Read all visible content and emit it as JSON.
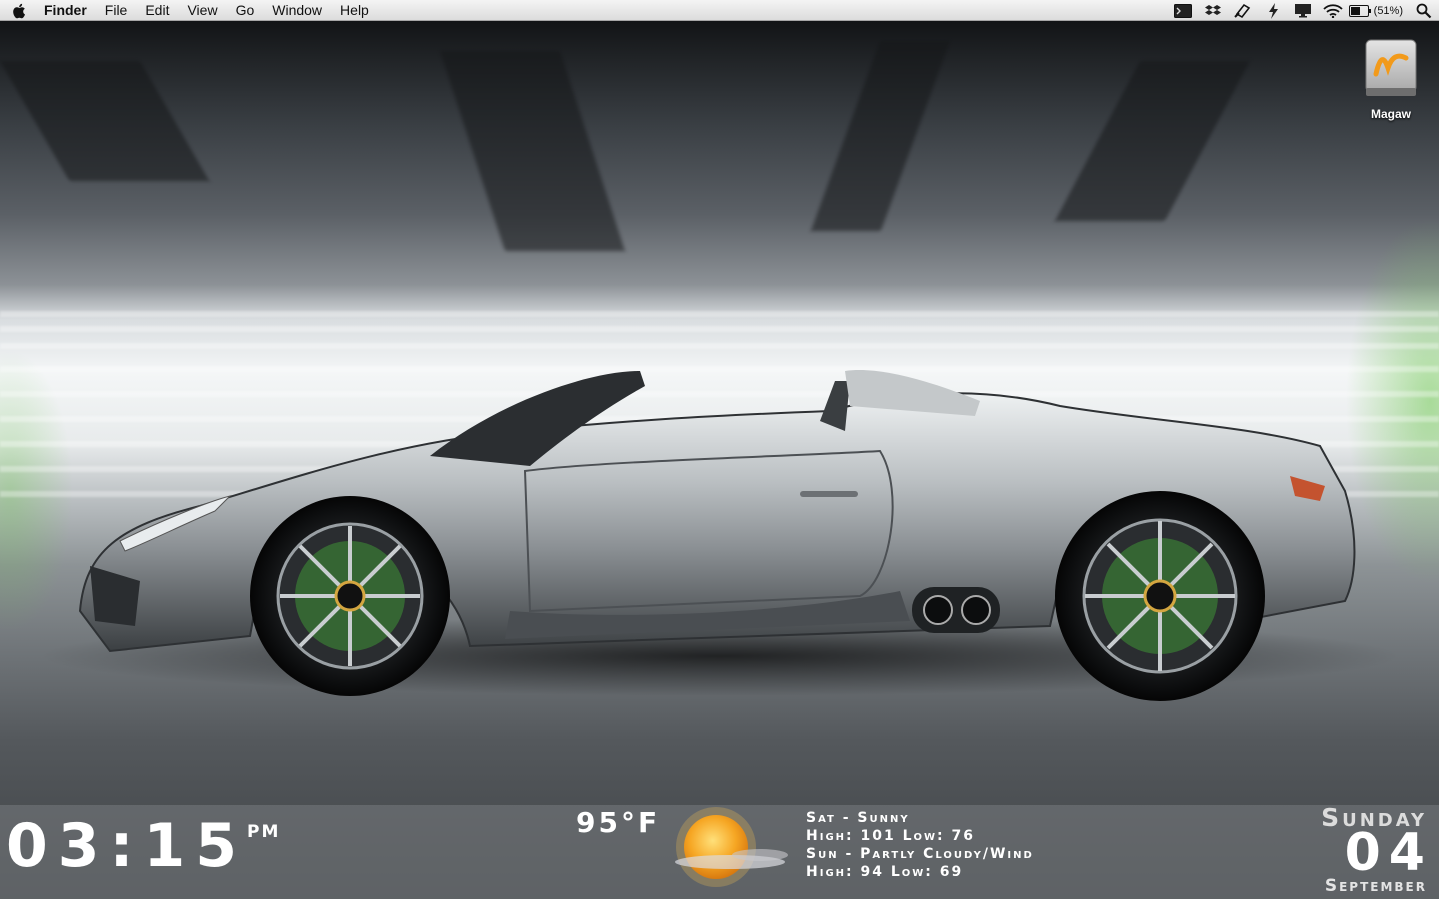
{
  "menubar": {
    "apple_icon": "apple-icon",
    "app_name": "Finder",
    "menus": [
      "File",
      "Edit",
      "View",
      "Go",
      "Window",
      "Help"
    ],
    "status_icons": [
      "terminal-icon",
      "dropbox-icon",
      "sync-icon",
      "flash-icon",
      "display-icon",
      "wifi-icon",
      "battery-icon"
    ],
    "battery_text": "(51%)",
    "spotlight_icon": "search-icon"
  },
  "desktop": {
    "icons": [
      {
        "label": "Magaw",
        "icon": "drive-icon"
      }
    ]
  },
  "widgets": {
    "clock": {
      "time": "03:15",
      "ampm": "PM"
    },
    "weather": {
      "temperature": "95°F",
      "icon": "sunny-icon",
      "forecast": [
        "Sat - Sunny",
        "High: 101 Low: 76",
        "Sun - Partly Cloudy/Wind",
        "High: 94 Low: 69"
      ]
    },
    "date": {
      "day_name": "Sunday",
      "day_number": "04",
      "month": "September"
    }
  },
  "colors": {
    "accent_green": "#6ec850",
    "car_silver": "#b9bec1",
    "menubar": "#e6e6e6"
  }
}
